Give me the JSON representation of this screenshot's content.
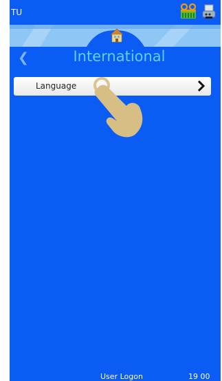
{
  "status": {
    "left_text": "TU"
  },
  "title": {
    "text": "International",
    "back_icon": "chevron-left-icon"
  },
  "menu": {
    "items": [
      {
        "label": "Language",
        "arrow_icon": "chevron-right-icon"
      }
    ]
  },
  "footer": {
    "label": "User Logon",
    "time": "19 00"
  },
  "icons": {
    "home": "home-icon",
    "ribbon": "ribbon-cassette-icon",
    "printer": "printer-icon",
    "pointer": "pointing-hand-icon"
  },
  "colors": {
    "background": "#0b5cf5",
    "title": "#5fd0ff",
    "home_bar": "#8ec6f5",
    "menu_item": "#f4f4f4",
    "pointer": "#d6be84"
  }
}
